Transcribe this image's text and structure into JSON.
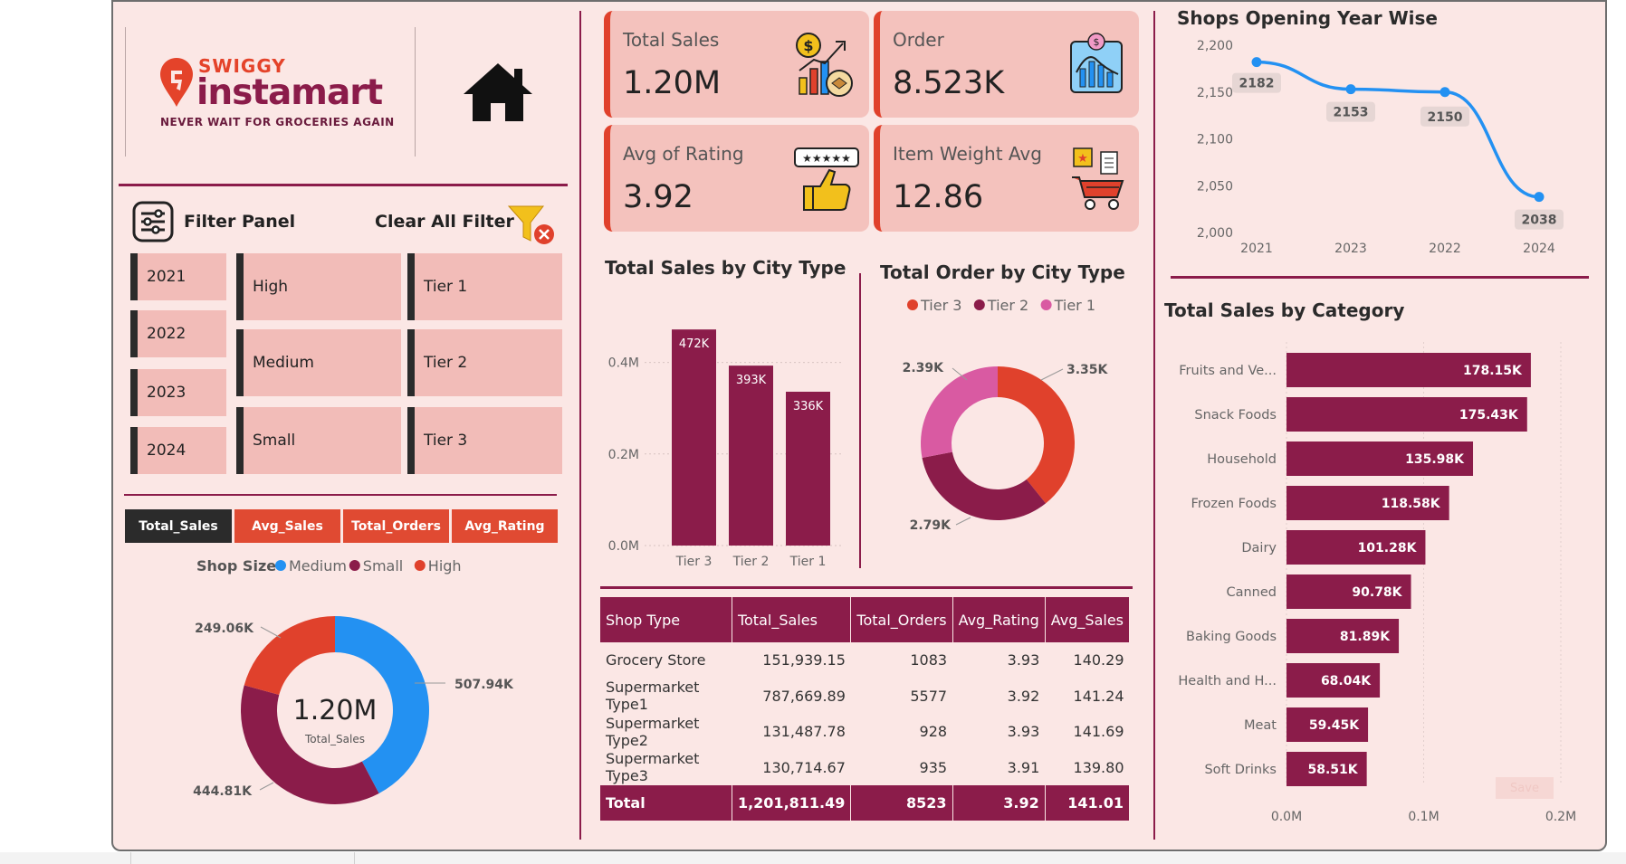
{
  "logo": {
    "brand_top": "SWIGGY",
    "brand_main": "instamart",
    "tagline": "NEVER WAIT FOR GROCERIES AGAIN"
  },
  "filter_panel": {
    "title": "Filter Panel",
    "clear_label": "Clear All Filter",
    "years": [
      "2021",
      "2022",
      "2023",
      "2024"
    ],
    "sizes": [
      "High",
      "Medium",
      "Small"
    ],
    "tiers": [
      "Tier 1",
      "Tier 2",
      "Tier 3"
    ]
  },
  "metric_buttons": [
    "Total_Sales",
    "Avg_Sales",
    "Total_Orders",
    "Avg_Rating"
  ],
  "kpis": {
    "total_sales": {
      "label": "Total Sales",
      "value": "1.20M"
    },
    "order": {
      "label": "Order",
      "value": "8.523K"
    },
    "avg_rating": {
      "label": "Avg of Rating",
      "value": "3.92"
    },
    "item_weight": {
      "label": "Item Weight Avg",
      "value": "12.86"
    }
  },
  "colors": {
    "maroon": "#8b1c4a",
    "red": "#e0412c",
    "pink": "#d95aa2",
    "blue": "#2391f2",
    "bg": "#fbe7e5"
  },
  "chart_data": [
    {
      "id": "shop_size",
      "type": "pie",
      "title": "",
      "legend_title": "Shop Size",
      "legend_placement": "top",
      "center_value": "1.20M",
      "center_label": "Total_Sales",
      "series": [
        {
          "name": "Medium",
          "value": 507.94,
          "label": "507.94K",
          "color": "#2391f2"
        },
        {
          "name": "Small",
          "value": 444.81,
          "label": "444.81K",
          "color": "#8b1c4a"
        },
        {
          "name": "High",
          "value": 249.06,
          "label": "249.06K",
          "color": "#e0412c"
        }
      ]
    },
    {
      "id": "sales_by_city",
      "type": "bar",
      "title": "Total Sales by City Type",
      "categories": [
        "Tier 3",
        "Tier 2",
        "Tier 1"
      ],
      "values": [
        472,
        393,
        336
      ],
      "data_labels": [
        "472K",
        "393K",
        "336K"
      ],
      "yticks": [
        "0.0M",
        "0.2M",
        "0.4M"
      ],
      "ylim": [
        0,
        500
      ],
      "grid": false
    },
    {
      "id": "order_by_city",
      "type": "pie",
      "title": "Total Order by City Type",
      "legend_placement": "top",
      "series": [
        {
          "name": "Tier 3",
          "value": 3.35,
          "label": "3.35K",
          "color": "#e0412c"
        },
        {
          "name": "Tier 2",
          "value": 2.79,
          "label": "2.79K",
          "color": "#8b1c4a"
        },
        {
          "name": "Tier 1",
          "value": 2.39,
          "label": "2.39K",
          "color": "#d95aa2"
        }
      ]
    },
    {
      "id": "opening_year",
      "type": "line",
      "title": "Shops Opening Year Wise",
      "categories": [
        "2021",
        "2023",
        "2022",
        "2024"
      ],
      "values": [
        2182,
        2153,
        2150,
        2038
      ],
      "yticks": [
        "2,000",
        "2,050",
        "2,100",
        "2,150",
        "2,200"
      ],
      "ylim": [
        2000,
        2200
      ],
      "color": "#2391f2"
    },
    {
      "id": "sales_by_category",
      "type": "bar",
      "orientation": "horizontal",
      "title": "Total Sales by Category",
      "categories": [
        "Fruits and Ve...",
        "Snack Foods",
        "Household",
        "Frozen Foods",
        "Dairy",
        "Canned",
        "Baking Goods",
        "Health and H...",
        "Meat",
        "Soft Drinks"
      ],
      "values": [
        178.15,
        175.43,
        135.98,
        118.58,
        101.28,
        90.78,
        81.89,
        68.04,
        59.45,
        58.51
      ],
      "data_labels": [
        "178.15K",
        "175.43K",
        "135.98K",
        "118.58K",
        "101.28K",
        "90.78K",
        "81.89K",
        "68.04K",
        "59.45K",
        "58.51K"
      ],
      "xticks": [
        "0.0M",
        "0.1M",
        "0.2M"
      ],
      "xlim": [
        0,
        200
      ]
    },
    {
      "id": "shop_type_table",
      "type": "table",
      "columns": [
        "Shop Type",
        "Total_Sales",
        "Total_Orders",
        "Avg_Rating",
        "Avg_Sales"
      ],
      "rows": [
        [
          "Grocery Store",
          "151,939.15",
          "1083",
          "3.93",
          "140.29"
        ],
        [
          "Supermarket Type1",
          "787,669.89",
          "5577",
          "3.92",
          "141.24"
        ],
        [
          "Supermarket Type2",
          "131,487.78",
          "928",
          "3.93",
          "141.69"
        ],
        [
          "Supermarket Type3",
          "130,714.67",
          "935",
          "3.91",
          "139.80"
        ]
      ],
      "total": [
        "Total",
        "1,201,811.49",
        "8523",
        "3.92",
        "141.01"
      ]
    }
  ],
  "watermark": "Save"
}
